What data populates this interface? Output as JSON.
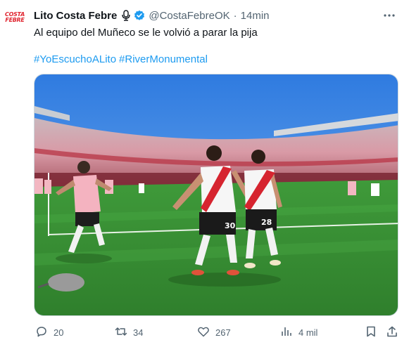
{
  "author": {
    "avatar_text_line1": "COSTA",
    "avatar_text_line2": "FEBRE",
    "name": "Lito Costa Febre",
    "handle": "@CostaFebreOK",
    "separator": "·",
    "time": "14min"
  },
  "tweet": {
    "text": "Al equipo del Muñeco se le volvió a parar la pija",
    "hashtags": [
      "#YoEscuchoALito",
      "#RiverMonumental"
    ]
  },
  "media": {
    "description_icon": "photo-stadium-celebration",
    "jersey_number_left": "30",
    "jersey_number_right": "28"
  },
  "actions": {
    "replies": "20",
    "reposts": "34",
    "likes": "267",
    "views": "4 mil"
  },
  "colors": {
    "link": "#1d9bf0",
    "verified": "#1d9bf0",
    "muted": "#536471",
    "brand_red": "#e0242f"
  }
}
